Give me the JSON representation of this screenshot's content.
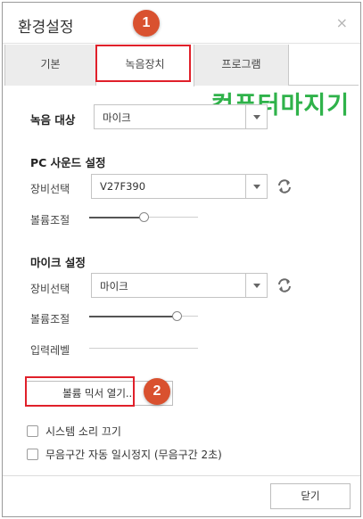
{
  "dialog": {
    "title": "환경설정",
    "close_glyph": "×"
  },
  "tabs": [
    {
      "label": "기본"
    },
    {
      "label": "녹음장치"
    },
    {
      "label": "프로그램"
    }
  ],
  "annotations": {
    "step1": "1",
    "step2": "2"
  },
  "watermark": {
    "text": "컴퓨터마지기",
    "color": "#2fb24a"
  },
  "record_target": {
    "label": "녹음 대상",
    "value": "마이크"
  },
  "pc_sound": {
    "heading": "PC 사운드 설정",
    "device_label": "장비선택",
    "device_value": "V27F390",
    "volume_label": "볼륨조절",
    "volume_level": 0.5
  },
  "mic": {
    "heading": "마이크 설정",
    "device_label": "장비선택",
    "device_value": "마이크",
    "volume_label": "볼륨조절",
    "volume_level": 0.8,
    "input_level_label": "입력레벨",
    "input_level": 0
  },
  "mixer_button": "볼륨 믹서 열기...",
  "options": [
    {
      "label": "시스템 소리 끄기",
      "checked": false
    },
    {
      "label": "무음구간 자동 일시정지 (무음구간 2초)",
      "checked": false
    }
  ],
  "footer": {
    "close_label": "닫기"
  },
  "colors": {
    "accent_red": "#e0202a",
    "badge": "#d9512f"
  }
}
